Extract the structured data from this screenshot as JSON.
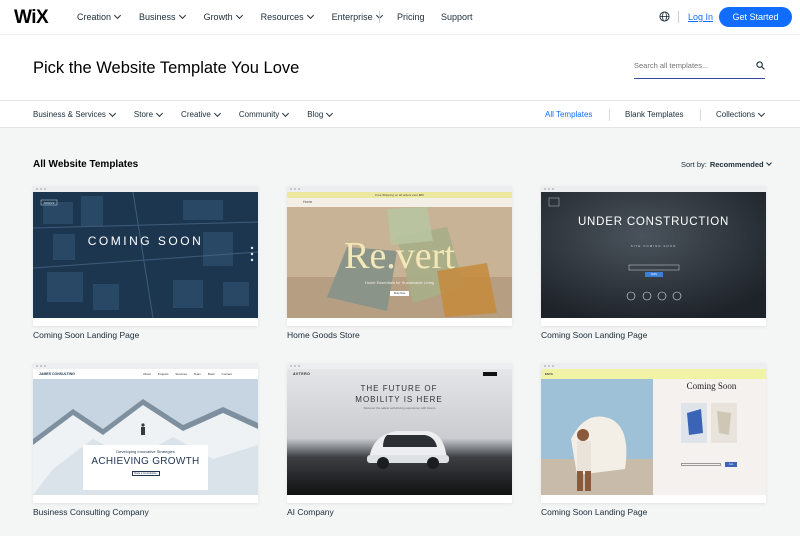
{
  "nav": {
    "logo": "WiX",
    "menu": [
      "Creation",
      "Business",
      "Growth",
      "Resources",
      "Enterprise"
    ],
    "pricing": "Pricing",
    "support": "Support",
    "login": "Log In",
    "cta": "Get Started"
  },
  "hero": {
    "title": "Pick the Website Template You Love",
    "search_placeholder": "Search all templates..."
  },
  "categories": [
    "Business & Services",
    "Store",
    "Creative",
    "Community",
    "Blog"
  ],
  "right_categories": {
    "all": "All Templates",
    "blank": "Blank Templates",
    "collections": "Collections"
  },
  "listing": {
    "title": "All Website Templates",
    "sort_label": "Sort by:",
    "sort_value": "Recommended"
  },
  "templates": [
    {
      "name": "Coming Soon Landing Page",
      "thumb": {
        "headline": "COMING SOON",
        "label": "ARGUS"
      }
    },
    {
      "name": "Home Goods Store",
      "thumb": {
        "headline": "Re.vert",
        "top": "Home",
        "sub": "Home Essentials for Sustainable Living",
        "btn": "Shop Now",
        "banner": "Free Shipping on all orders over $80"
      }
    },
    {
      "name": "Coming Soon Landing Page",
      "thumb": {
        "headline": "UNDER CONSTRUCTION",
        "sub": "SITE COMING SOON",
        "btn": "Notify"
      }
    },
    {
      "name": "Business Consulting Company",
      "thumb": {
        "brand": "JAMES CONSULTING",
        "kicker": "Developing Innovative Strategies",
        "headline": "ACHIEVING GROWTH",
        "btn": "Book a Consultation",
        "links": [
          "About",
          "Projects",
          "Services",
          "Team",
          "Book",
          "Contact"
        ]
      }
    },
    {
      "name": "AI Company",
      "thumb": {
        "brand": "AVTERO",
        "headline": "THE FUTURE OF MOBILITY IS HERE",
        "sub": "Discover the safest self-driving experience with Avtero"
      }
    },
    {
      "name": "Coming Soon Landing Page",
      "thumb": {
        "headline": "Coming Soon",
        "brand": "ESYA",
        "btn": "Join"
      }
    }
  ],
  "colors": {
    "accent": "#116dff",
    "heading": "#000000",
    "text": "#20303c",
    "page_bg": "#f4f5f5"
  }
}
